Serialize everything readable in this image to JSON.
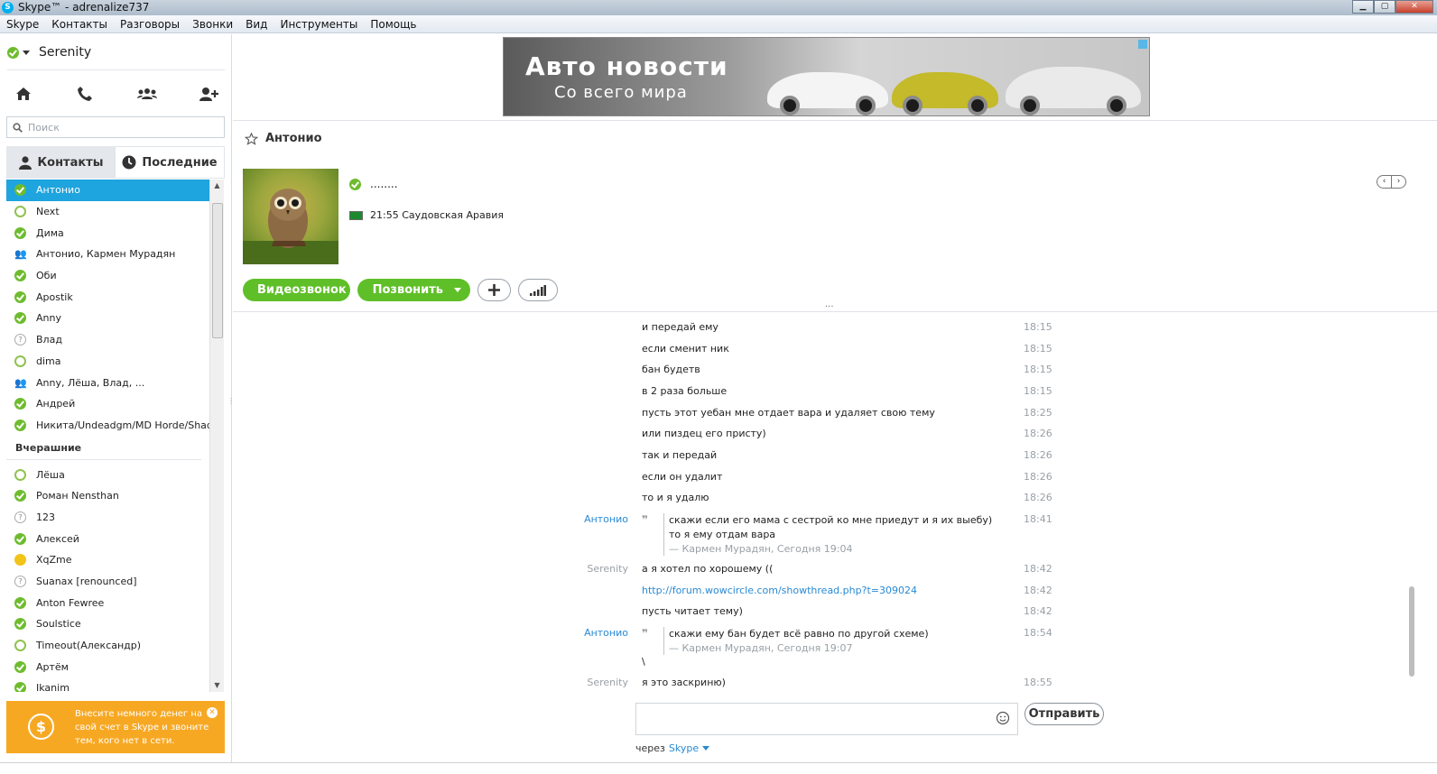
{
  "window": {
    "title": "Skype™ - adrenalize737",
    "app_icon": "S",
    "controls": [
      "minimize",
      "maximize",
      "close"
    ]
  },
  "menu": [
    "Skype",
    "Контакты",
    "Разговоры",
    "Звонки",
    "Вид",
    "Инструменты",
    "Помощь"
  ],
  "profile": {
    "name": "Serenity",
    "status": "online"
  },
  "nav_icons": [
    "home-icon",
    "phone-icon",
    "group-icon",
    "add-contact-icon"
  ],
  "search": {
    "placeholder": "Поиск"
  },
  "tabs": {
    "contacts": "Контакты",
    "recent": "Последние"
  },
  "contacts_today": [
    {
      "name": "Антонио",
      "status": "online",
      "active": true
    },
    {
      "name": "Next",
      "status": "offline"
    },
    {
      "name": "Дима",
      "status": "online"
    },
    {
      "name": "Антонио, Кармен Мурадян",
      "status": "group"
    },
    {
      "name": "Оби",
      "status": "online"
    },
    {
      "name": "Apostik",
      "status": "online"
    },
    {
      "name": "Anny",
      "status": "online"
    },
    {
      "name": "Влад",
      "status": "unknown"
    },
    {
      "name": "dima",
      "status": "offline"
    },
    {
      "name": "Anny, Лёша, Влад, ...",
      "status": "group"
    },
    {
      "name": "Андрей",
      "status": "online"
    },
    {
      "name": "Никита/Undeadgm/MD Horde/Shado...",
      "status": "online"
    }
  ],
  "group_yesterday": "Вчерашние",
  "contacts_yesterday": [
    {
      "name": "Лёша",
      "status": "offline"
    },
    {
      "name": "Роман Nensthan",
      "status": "online"
    },
    {
      "name": "123",
      "status": "unknown"
    },
    {
      "name": "Алексей",
      "status": "online"
    },
    {
      "name": "XqZme",
      "status": "away"
    },
    {
      "name": "Suanax [renounced]",
      "status": "unknown"
    },
    {
      "name": "Anton Fewree",
      "status": "online"
    },
    {
      "name": "Soulstice",
      "status": "online"
    },
    {
      "name": "Timeout(Александр)",
      "status": "offline"
    },
    {
      "name": "Артём",
      "status": "online"
    },
    {
      "name": "Ikanim",
      "status": "online"
    }
  ],
  "promo": {
    "text": "Внесите немного денег на свой счет в Skype и звоните тем, кого нет в сети.",
    "icon": "dollar-coin-icon"
  },
  "ad": {
    "title": "Авто новости",
    "subtitle": "Со всего мира"
  },
  "contact": {
    "name": "Антонио",
    "mood": "........",
    "local_time": "21:55 Саудовская Аравия"
  },
  "actions": {
    "video": "Видеозвонок",
    "call": "Позвонить"
  },
  "messages": [
    {
      "sender": "",
      "text": "и передай ему",
      "time": "18:15"
    },
    {
      "sender": "",
      "text": "если сменит ник",
      "time": "18:15"
    },
    {
      "sender": "",
      "text": "бан будетв",
      "time": "18:15"
    },
    {
      "sender": "",
      "text": "в 2 раза больше",
      "time": "18:15"
    },
    {
      "sender": "",
      "text": "пусть этот уебан мне отдает вара и удаляет свою тему",
      "time": "18:25"
    },
    {
      "sender": "",
      "text": "или пиздец его присту)",
      "time": "18:26"
    },
    {
      "sender": "",
      "text": "так и передай",
      "time": "18:26"
    },
    {
      "sender": "",
      "text": "если он удалит",
      "time": "18:26"
    },
    {
      "sender": "",
      "text": "то и я удалю",
      "time": "18:26"
    }
  ],
  "quote1": {
    "sender": "Антонио",
    "text": "скажи если его мама с сестрой ко мне приедут и я их выебу) то я ему отдам вара",
    "attr": "— Кармен Мурадян, Сегодня 19:04",
    "time": "18:41"
  },
  "messages2": [
    {
      "sender": "Serenity",
      "text": "а я хотел по хорошему ((",
      "time": "18:42"
    },
    {
      "sender": "",
      "text": "http://forum.wowcircle.com/showthread.php?t=309024",
      "time": "18:42",
      "link": true
    },
    {
      "sender": "",
      "text": "пусть читает тему)",
      "time": "18:42"
    }
  ],
  "quote2": {
    "sender": "Антонио",
    "text": "скажи ему бан будет всё равно по другой схеме)",
    "attr": "— Кармен Мурадян, Сегодня 19:07",
    "extra": "\\",
    "time": "18:54"
  },
  "last_message": {
    "sender": "Serenity",
    "text": "я это заскриню)",
    "time": "18:55"
  },
  "composer": {
    "send": "Отправить",
    "via_label": "через",
    "via_service": "Skype"
  }
}
